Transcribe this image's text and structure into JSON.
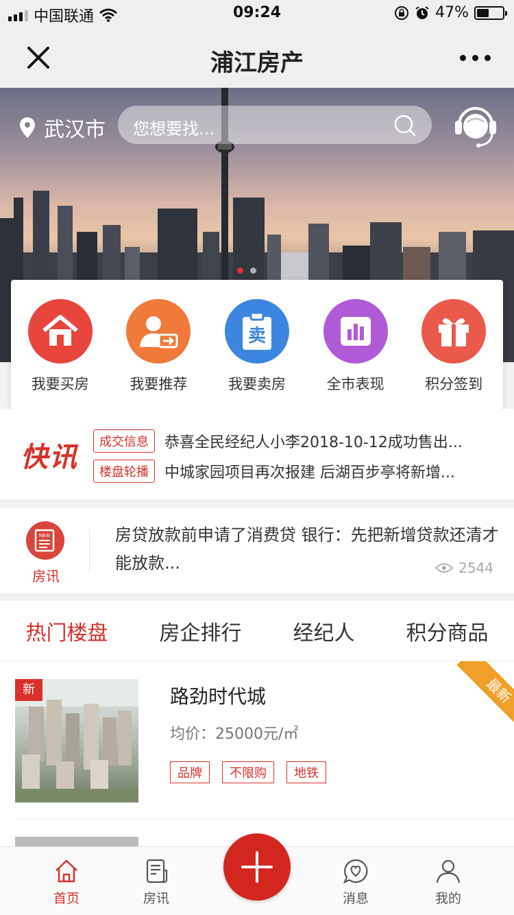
{
  "status_bar": {
    "carrier": "中国联通",
    "time": "09:24",
    "battery": "47%"
  },
  "navbar": {
    "title": "浦江房产"
  },
  "hero": {
    "city": "武汉市",
    "search_placeholder": "您想要找..."
  },
  "menu": [
    {
      "label": "我要买房",
      "color": "#e8453c",
      "icon": "house-icon"
    },
    {
      "label": "我要推荐",
      "color": "#f07a3a",
      "icon": "refer-icon"
    },
    {
      "label": "我要卖房",
      "color": "#3d86e0",
      "icon": "sell-icon",
      "glyph": "卖"
    },
    {
      "label": "全市表现",
      "color": "#b15ad6",
      "icon": "chart-icon"
    },
    {
      "label": "积分签到",
      "color": "#ea5a4a",
      "icon": "gift-icon"
    }
  ],
  "flash": {
    "logo": "快讯",
    "items": [
      {
        "tag": "成交信息",
        "text": "恭喜全民经纪人小李2018-10-12成功售出..."
      },
      {
        "tag": "楼盘轮播",
        "text": "中城家园项目再次报建 后湖百步亭将新增..."
      }
    ]
  },
  "house_news": {
    "icon_text": "NEW",
    "label": "房讯",
    "text": "房贷放款前申请了消费贷 银行：先把新增贷款还清才能放款...",
    "views": "2544"
  },
  "tabs": [
    "热门楼盘",
    "房企排行",
    "经纪人",
    "积分商品"
  ],
  "listing": {
    "badge": "新",
    "ribbon": "最新",
    "name": "路劲时代城",
    "price": "均价：25000元/㎡",
    "tags": [
      "品牌",
      "不限购",
      "地铁"
    ]
  },
  "bottom_nav": {
    "home": "首页",
    "news": "房讯",
    "messages": "消息",
    "mine": "我的"
  }
}
